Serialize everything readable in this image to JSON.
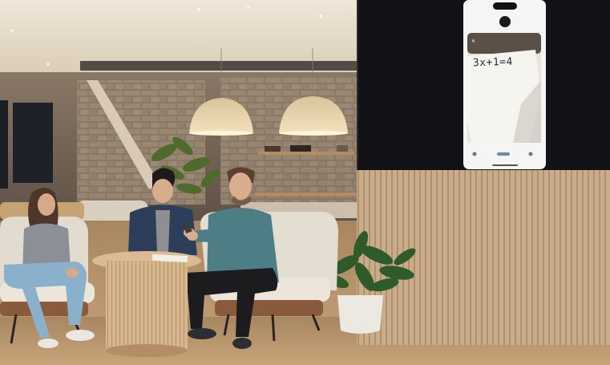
{
  "phone_screen": {
    "handwritten_equation": "3x+1=4"
  },
  "colors": {
    "ceiling": "#e6dccd",
    "floor": "#b8966d",
    "wood_panel": "#c8ab87",
    "tv_bezel": "#101010",
    "phone_screen": "#f4f4f4",
    "lamp_shade": "#e9d7b4"
  }
}
